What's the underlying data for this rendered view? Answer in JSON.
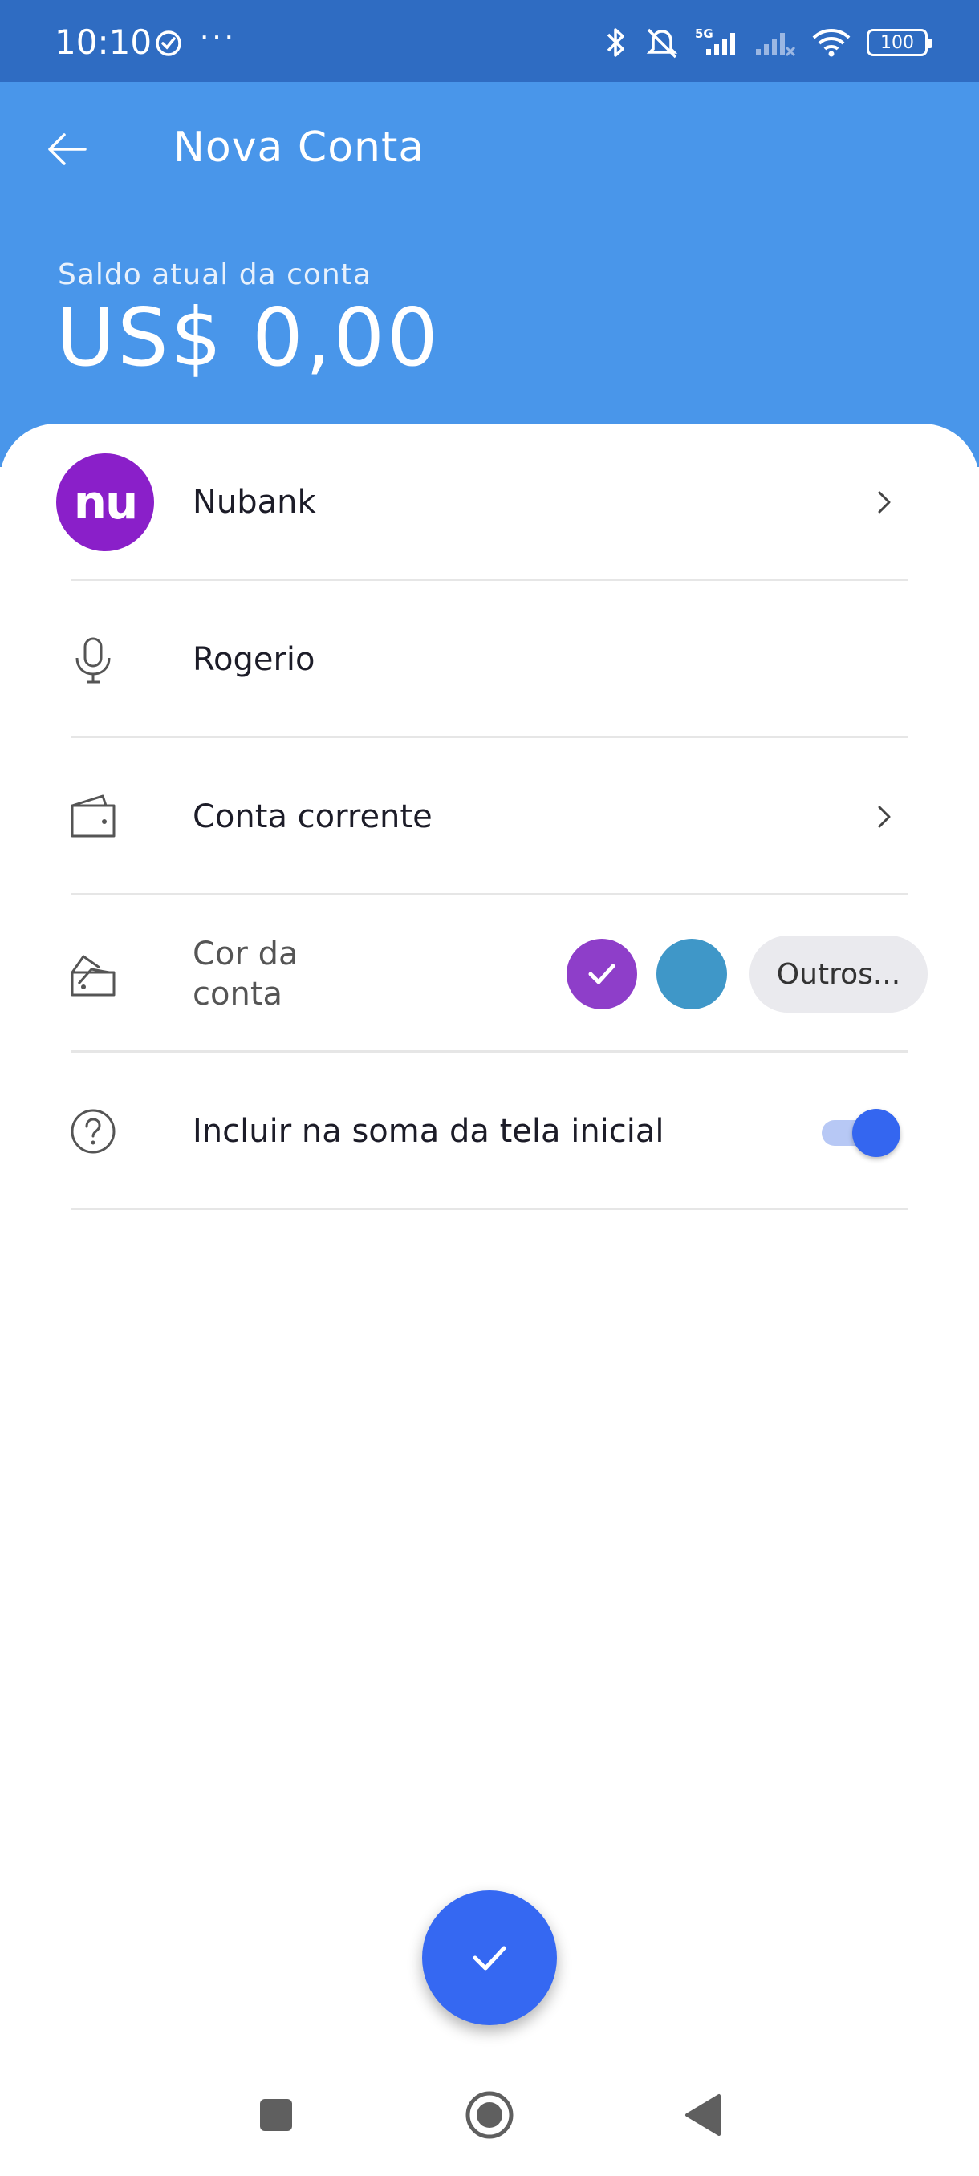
{
  "status_bar": {
    "time": "10:10",
    "battery": "100",
    "signal_label": "5G"
  },
  "header": {
    "title": "Nova Conta",
    "balance_label": "Saldo atual da conta",
    "balance_value": "US$ 0,00"
  },
  "form": {
    "bank": {
      "logo_text": "nu",
      "name": "Nubank"
    },
    "account_name": {
      "value": "Rogerio"
    },
    "account_type": {
      "value": "Conta corrente"
    },
    "account_color": {
      "label": "Cor da conta",
      "swatches": [
        {
          "color": "#8e3ec9",
          "selected": true
        },
        {
          "color": "#3f97c8",
          "selected": false
        }
      ],
      "other_button": "Outros..."
    },
    "include_sum": {
      "label": "Incluir na soma da tela inicial",
      "enabled": true
    }
  },
  "colors": {
    "status_bar": "#2f6cc2",
    "header": "#4996ea",
    "accent": "#3568f2",
    "nubank": "#8a1fc9"
  }
}
